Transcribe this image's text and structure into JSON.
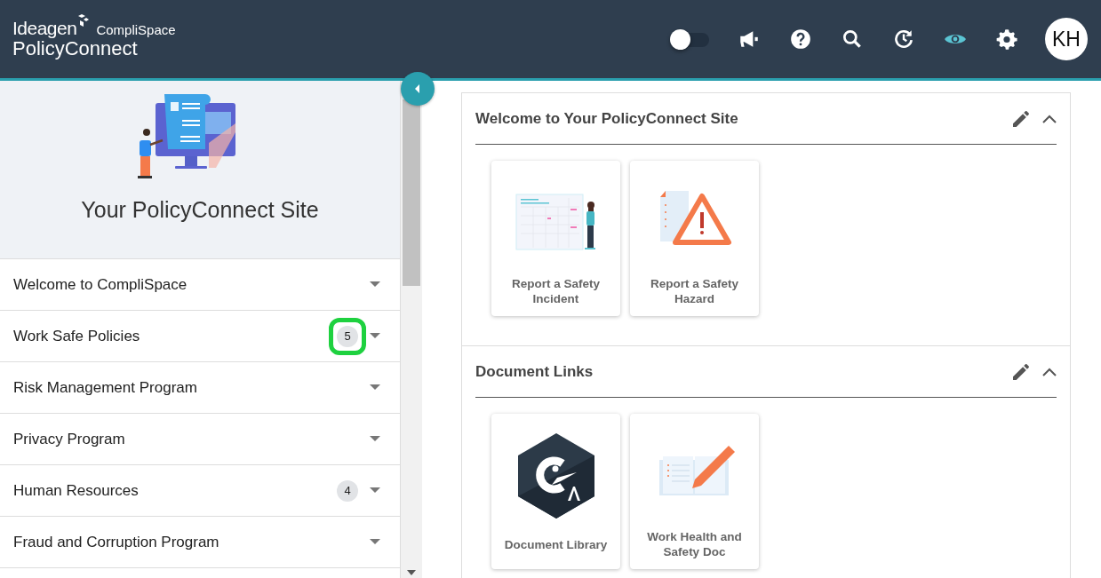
{
  "header": {
    "brand": "Ideagen",
    "product": "CompliSpace",
    "app": "PolicyConnect",
    "toggle": {
      "on": false
    },
    "icons": [
      {
        "kind": "announce",
        "selected": false
      },
      {
        "kind": "help",
        "selected": false
      },
      {
        "kind": "search",
        "selected": false
      },
      {
        "kind": "history",
        "selected": false
      },
      {
        "kind": "view",
        "selected": true
      },
      {
        "kind": "settings",
        "selected": false
      }
    ],
    "avatar": "KH"
  },
  "sidebar": {
    "title": "Your PolicyConnect Site",
    "items": [
      {
        "label": "Welcome to CompliSpace",
        "highlighted": false
      },
      {
        "label": "Work Safe Policies",
        "count": "5",
        "highlighted": true
      },
      {
        "label": "Risk Management Program",
        "highlighted": false
      },
      {
        "label": "Privacy Program",
        "highlighted": false
      },
      {
        "label": "Human Resources",
        "count": "4",
        "highlighted": false
      },
      {
        "label": "Fraud and Corruption Program",
        "highlighted": false
      }
    ]
  },
  "sections": [
    {
      "title": "Welcome to Your PolicyConnect Site",
      "expanded": true,
      "tiles": [
        {
          "label": "Report a Safety Incident",
          "kind": "calendar"
        },
        {
          "label": "Report a Safety Hazard",
          "kind": "hazard"
        }
      ]
    },
    {
      "title": "Document Links",
      "expanded": true,
      "tiles": [
        {
          "label": "Document Library",
          "kind": "hexagon"
        },
        {
          "label": "Work Health and Safety Doc",
          "kind": "book"
        }
      ]
    }
  ]
}
